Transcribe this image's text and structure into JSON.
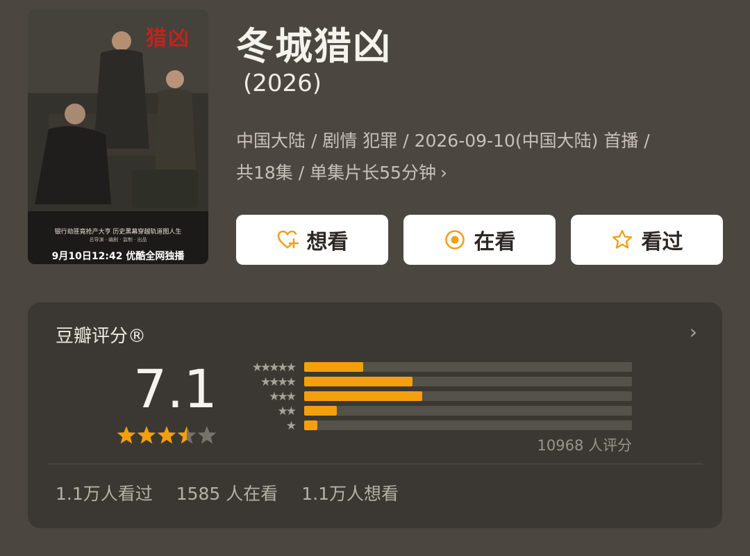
{
  "poster": {
    "title_art": "猎凶",
    "tagline": "银行劫匪竟抢产大亨  历史黑幕穿越轨道图人生",
    "credits": "总导演 ·  编剧 ·  监制 ·  出品",
    "release": "9月10日12:42 优酷全网独播"
  },
  "show": {
    "title": "冬城猎凶",
    "year": "(2026)",
    "meta_line1": "中国大陆 / 剧情 犯罪 / 2026-09-10(中国大陆) 首播 /",
    "meta_line2": "共18集 / 单集片长55分钟"
  },
  "actions": [
    {
      "label": "想看",
      "icon": "heart-plus-icon"
    },
    {
      "label": "在看",
      "icon": "target-circle-icon"
    },
    {
      "label": "看过",
      "icon": "star-outline-icon"
    }
  ],
  "rating": {
    "title": "豆瓣评分®",
    "score": "7.1",
    "stars": 3.5,
    "distribution": [
      {
        "label": "★★★★★",
        "fraction": 0.18
      },
      {
        "label": "★★★★",
        "fraction": 0.33
      },
      {
        "label": "★★★",
        "fraction": 0.36
      },
      {
        "label": "★★",
        "fraction": 0.1
      },
      {
        "label": "★",
        "fraction": 0.04
      }
    ],
    "count_text": "10968 人评分",
    "watched": "1.1万人看过",
    "watching": "1585 人在看",
    "want": "1.1万人想看"
  },
  "colors": {
    "accent": "#f3a00c",
    "background": "#4b4640",
    "card": "#3b3833"
  }
}
